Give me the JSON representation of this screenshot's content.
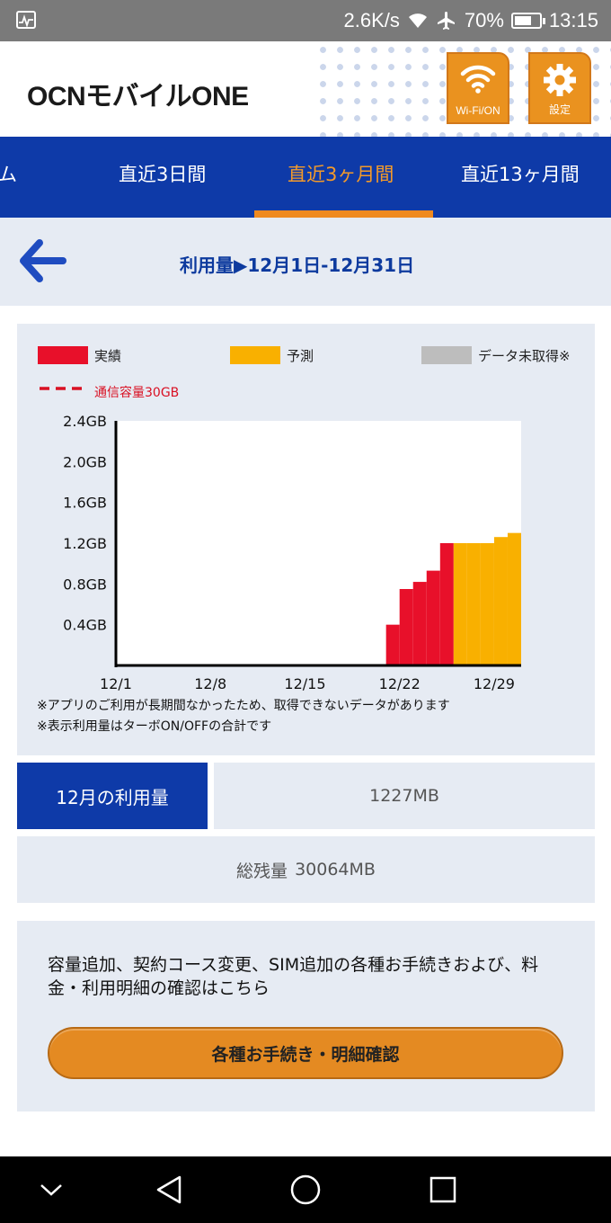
{
  "status_bar": {
    "speed": "2.6K/s",
    "battery": "70%",
    "battery_level": 0.7,
    "time": "13:15",
    "icons": [
      "activity-icon",
      "wifi-icon",
      "airplane-icon",
      "battery-icon"
    ]
  },
  "header": {
    "logo": "OCNモバイルONE",
    "wifi_button_label": "Wi-Fi/ON",
    "settings_button_label": "設定",
    "accent_color": "#ea921f"
  },
  "tabs": [
    {
      "label": "ム",
      "active": false
    },
    {
      "label": "直近3日間",
      "active": false
    },
    {
      "label": "直近3ヶ月間",
      "active": true
    },
    {
      "label": "直近13ヶ月間",
      "active": false
    }
  ],
  "period": {
    "title": "利用量▶12月1日-12月31日"
  },
  "legend": {
    "actual": "実績",
    "forecast": "予測",
    "unavailable": "データ未取得※",
    "capacity": "通信容量30GB"
  },
  "colors": {
    "actual": "#e8102a",
    "forecast": "#f9b000",
    "unavailable": "#bdbdbd",
    "capacity_line": "#d91023",
    "brand_blue": "#0e3aa8"
  },
  "chart_data": {
    "type": "area",
    "title": "",
    "xlabel": "",
    "ylabel": "",
    "unit": "GB",
    "x_ticks": [
      "12/1",
      "12/8",
      "12/15",
      "12/22",
      "12/29"
    ],
    "y_ticks": [
      "2.4GB",
      "2.0GB",
      "1.6GB",
      "1.2GB",
      "0.8GB",
      "0.4GB"
    ],
    "ylim": [
      0,
      2.4
    ],
    "xlim": [
      1,
      31
    ],
    "grid": false,
    "legend_position": "top",
    "series": [
      {
        "name": "実績",
        "x": [
          21,
          22,
          23,
          24,
          25,
          26
        ],
        "values": [
          0.4,
          0.75,
          0.82,
          0.93,
          1.2,
          1.2
        ]
      },
      {
        "name": "予測",
        "x": [
          26,
          27,
          28,
          29,
          30,
          31
        ],
        "values": [
          1.2,
          1.2,
          1.2,
          1.26,
          1.3,
          1.32
        ]
      }
    ]
  },
  "notes": [
    "※アプリのご利用が長期間なかったため、取得できないデータがあります",
    "※表示利用量はターボON/OFFの合計です"
  ],
  "usage": {
    "label": "12月の利用量",
    "value": "1227MB"
  },
  "remaining": {
    "label": "総残量",
    "value": "30064MB"
  },
  "procedures": {
    "text": "容量追加、契約コース変更、SIM追加の各種お手続きおよび、料金・利用明細の確認はこちら",
    "button_label": "各種お手続き・明細確認"
  }
}
